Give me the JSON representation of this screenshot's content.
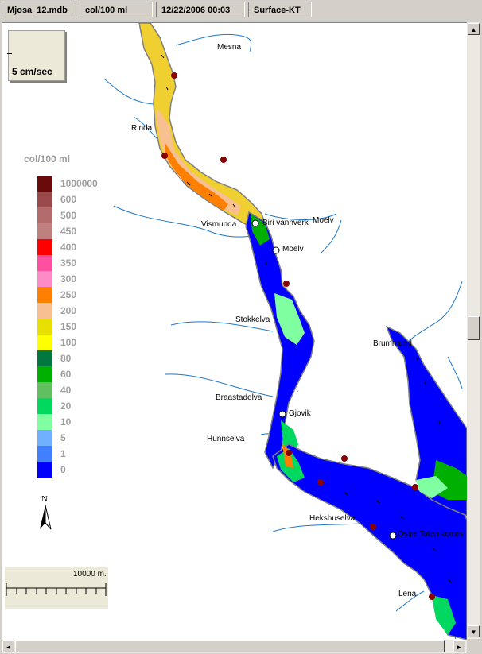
{
  "statusbar": {
    "file": "Mjosa_12.mdb",
    "units": "col/100 ml",
    "datetime": "12/22/2006 00:03",
    "layer": "Surface-KT"
  },
  "speed_scale": {
    "label": "5 cm/sec"
  },
  "legend": {
    "title": "col/100 ml",
    "items": [
      {
        "label": "1000000",
        "color": "#6b0a0a"
      },
      {
        "label": "600",
        "color": "#9a4a4a"
      },
      {
        "label": "500",
        "color": "#b46b6b"
      },
      {
        "label": "450",
        "color": "#c08080"
      },
      {
        "label": "400",
        "color": "#ff0000"
      },
      {
        "label": "350",
        "color": "#ff4fa0"
      },
      {
        "label": "300",
        "color": "#ff8ac8"
      },
      {
        "label": "250",
        "color": "#ff8000"
      },
      {
        "label": "200",
        "color": "#f8c090"
      },
      {
        "label": "150",
        "color": "#e8e000"
      },
      {
        "label": "100",
        "color": "#ffff00"
      },
      {
        "label": "80",
        "color": "#007840"
      },
      {
        "label": "60",
        "color": "#00b000"
      },
      {
        "label": "40",
        "color": "#60c060"
      },
      {
        "label": "20",
        "color": "#00d860"
      },
      {
        "label": "10",
        "color": "#80ffa0"
      },
      {
        "label": "5",
        "color": "#70b0ff"
      },
      {
        "label": "1",
        "color": "#4080ff"
      },
      {
        "label": "0",
        "color": "#0000ff"
      }
    ]
  },
  "north_arrow": {
    "label": "N"
  },
  "scale_bar": {
    "label": "10000 m."
  },
  "places": {
    "mesna": "Mesna",
    "rinda": "Rinda",
    "vismunda": "Vismunda",
    "biri": "Biri vannverk",
    "moelv_river": "Moelv",
    "moelv_town": "Moelv",
    "stokkelva": "Stokkelva",
    "brummund": "Brummund",
    "braastadelva": "Braastadelva",
    "gjovik": "Gjovik",
    "hunnselva": "Hunnselva",
    "hekshuselva": "Hekshuselva",
    "ostre_toten": "Ostre Toten komm",
    "lena": "Lena"
  },
  "colors": {
    "water_zero": "#0000ff",
    "shoreline": "#808080",
    "rivers": "#1e78c8",
    "station": "#8b0000"
  }
}
